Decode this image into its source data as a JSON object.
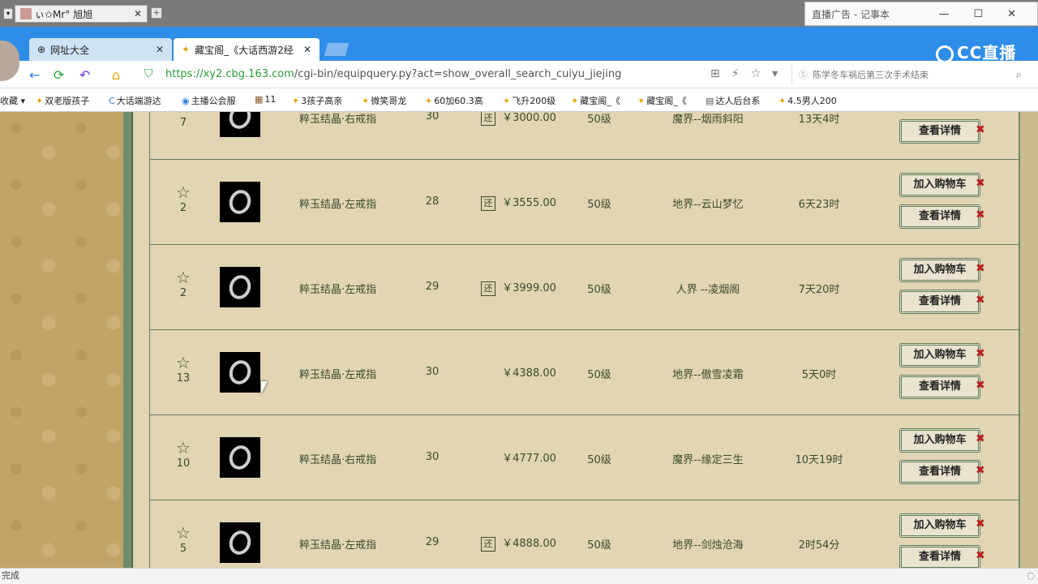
{
  "os": {
    "tab_title": "ぃ✩Mr°  旭旭",
    "close": "✕",
    "plus": "+",
    "notepad_title": "直播广告 - 记事本",
    "notepad_controls": [
      "—",
      "☐",
      "✕"
    ]
  },
  "browser": {
    "tabs": [
      {
        "label": "网址大全",
        "close": "✕"
      },
      {
        "label": "藏宝阁_《大话西游2经",
        "close": "✕"
      }
    ],
    "cc_logo": "CC直播",
    "url_host": "https://xy2.cbg.163.com",
    "url_path": "/cgi-bin/equipquery.py?act=show_overall_search_cuiyu_jiejing",
    "search_placeholder": "陈学冬车祸后第三次手术结束"
  },
  "bookmarks": [
    {
      "label": "收藏"
    },
    {
      "label": "双老版孩子"
    },
    {
      "label": "大话端游达"
    },
    {
      "label": "主播公会服"
    },
    {
      "label": "11"
    },
    {
      "label": "3孩子高亲"
    },
    {
      "label": "微笑哥龙"
    },
    {
      "label": "60加60.3高"
    },
    {
      "label": "飞升200级"
    },
    {
      "label": "藏宝阁_《"
    },
    {
      "label": "藏宝阁_《"
    },
    {
      "label": "达人后台系"
    },
    {
      "label": "4.5男人200"
    }
  ],
  "table": {
    "rows": [
      {
        "fav": "7",
        "name": "粹玉结晶·右戒指",
        "level": "30",
        "has_huan": true,
        "price": "￥3000.00",
        "plevel": "50级",
        "server": "魔界--烟雨斜阳",
        "time": "13天4时"
      },
      {
        "fav": "2",
        "name": "粹玉结晶·左戒指",
        "level": "28",
        "has_huan": true,
        "price": "￥3555.00",
        "plevel": "50级",
        "server": "地界--云山梦忆",
        "time": "6天23时"
      },
      {
        "fav": "2",
        "name": "粹玉结晶·左戒指",
        "level": "29",
        "has_huan": true,
        "price": "￥3999.00",
        "plevel": "50级",
        "server": "人界 --凌烟阁",
        "time": "7天20时"
      },
      {
        "fav": "13",
        "name": "粹玉结晶·左戒指",
        "level": "30",
        "has_huan": false,
        "price": "￥4388.00",
        "plevel": "50级",
        "server": "地界--傲雪凌霜",
        "time": "5天0时"
      },
      {
        "fav": "10",
        "name": "粹玉结晶·右戒指",
        "level": "30",
        "has_huan": false,
        "price": "￥4777.00",
        "plevel": "50级",
        "server": "魔界--缘定三生",
        "time": "10天19时"
      },
      {
        "fav": "5",
        "name": "粹玉结晶·左戒指",
        "level": "29",
        "has_huan": true,
        "price": "￥4888.00",
        "plevel": "50级",
        "server": "地界--剑烛沧海",
        "time": "2时54分"
      }
    ],
    "add_cart_label": "加入购物车",
    "detail_label": "查看详情",
    "huan_label": "还"
  },
  "status": {
    "text": "完成"
  }
}
